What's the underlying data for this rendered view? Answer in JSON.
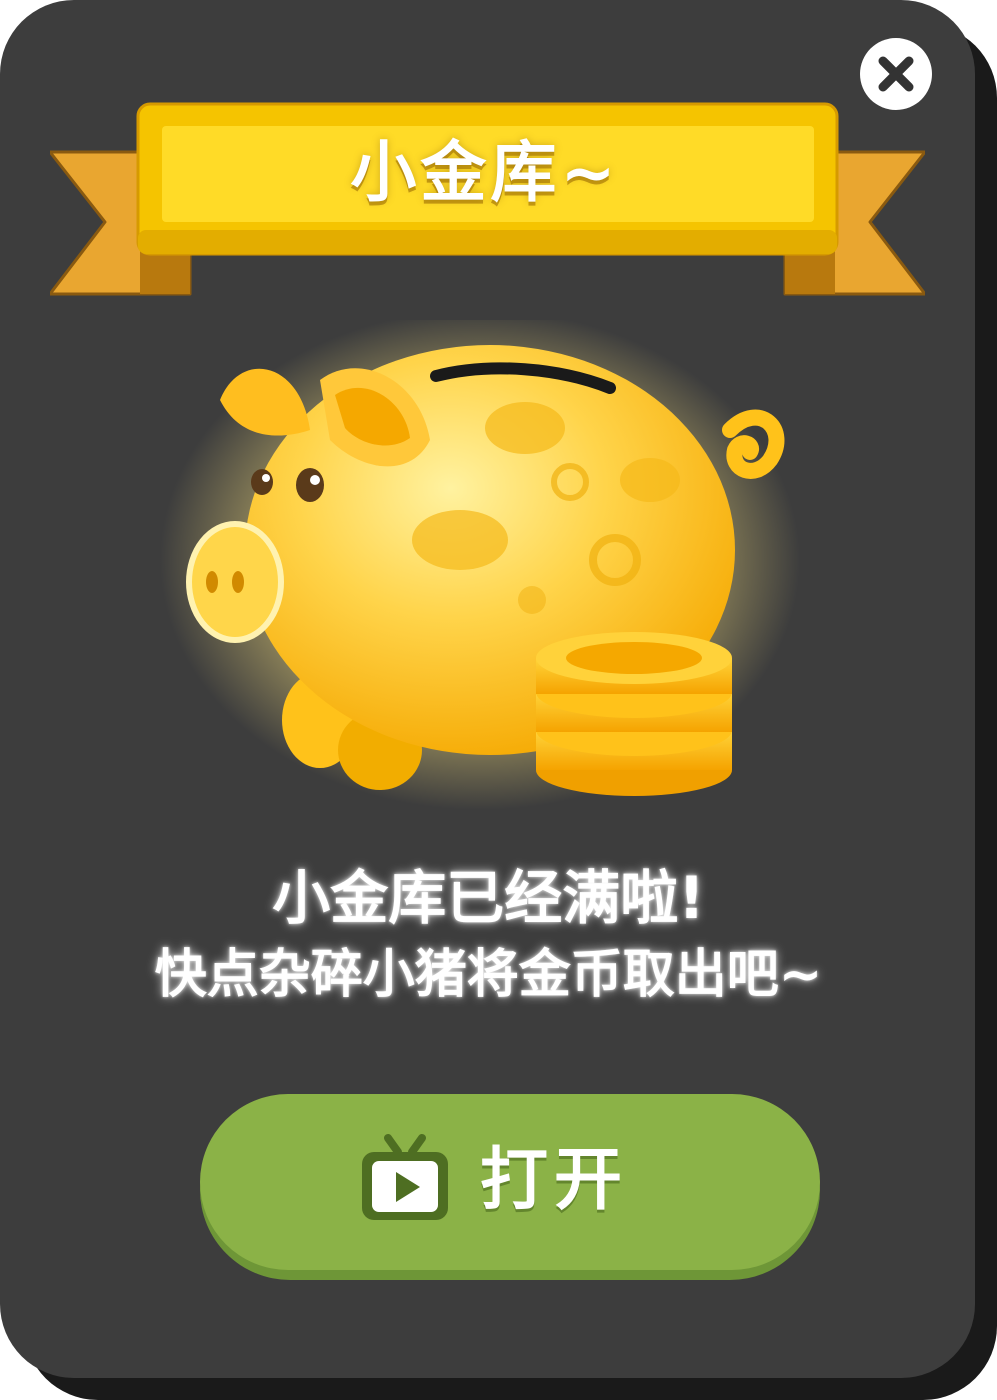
{
  "dialog": {
    "title": "小金库~",
    "close_icon": "close-icon",
    "message_line1": "小金库已经满啦!",
    "message_line2": "快点杂碎小猪将金币取出吧~",
    "open_button": {
      "label": "打开",
      "icon": "video-play-icon"
    }
  },
  "colors": {
    "panel": "#3d3d3d",
    "panel_shadow": "#1a1a1a",
    "ribbon": "#f5c400",
    "ribbon_tail": "#e9a630",
    "button": "#8bb247",
    "button_shadow": "#6e9637",
    "icon_green": "#5a7a2a",
    "gold": "#ffc21a"
  }
}
